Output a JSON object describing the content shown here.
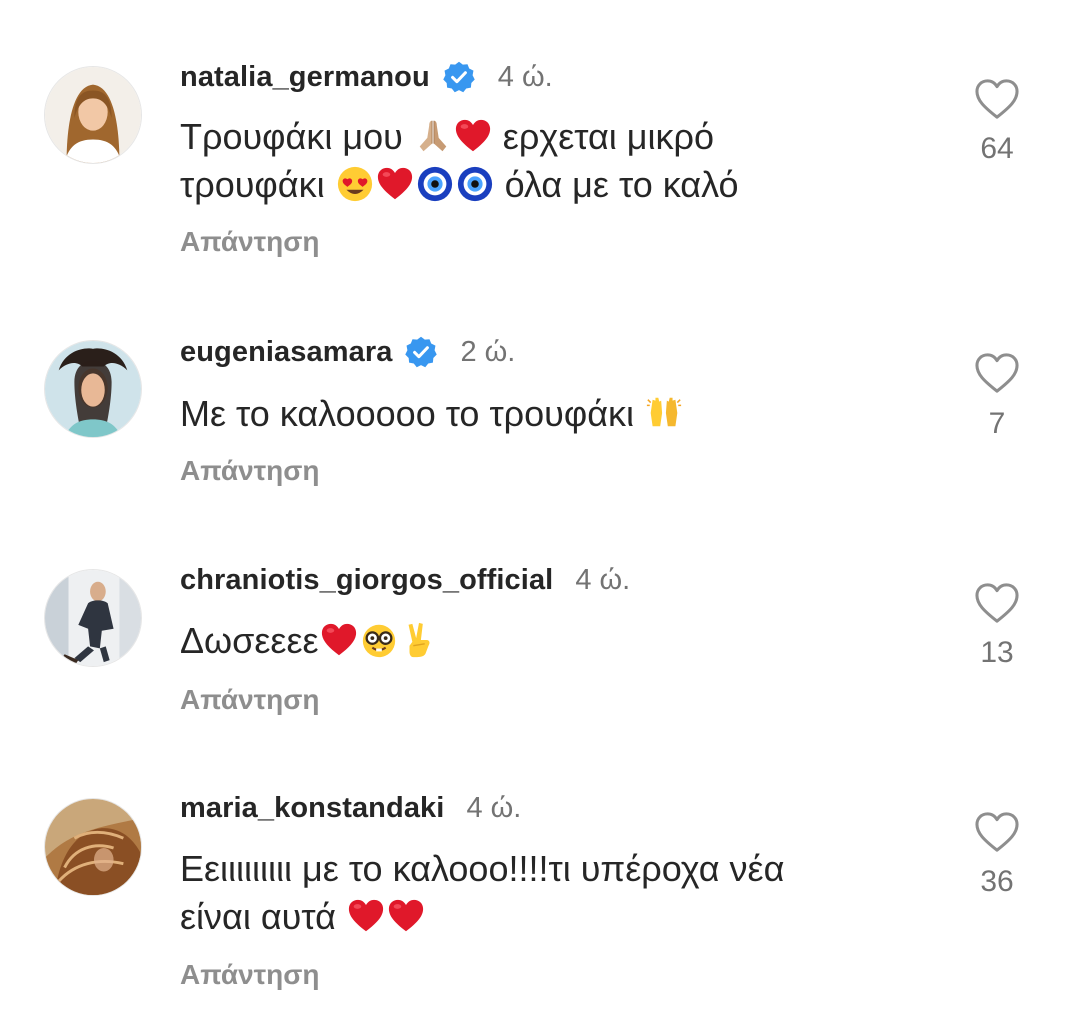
{
  "colors": {
    "primary_text": "#262626",
    "secondary_text": "#737373",
    "reply_text": "#8e8e8e",
    "verified_blue": "#3897f0"
  },
  "comments": [
    {
      "username": "natalia_germanou",
      "verified": true,
      "time": "4 ώ.",
      "text_part_1": "Τρουφάκι μου ",
      "text_part_2": " ερχεται μικρό",
      "text_part_3": "τρουφάκι ",
      "text_part_4": " όλα με το καλό",
      "reply_label": "Απάντηση",
      "likes": "64"
    },
    {
      "username": "eugeniasamara",
      "verified": true,
      "time": "2 ώ.",
      "text_part_1": "Με το καλοοοοο το τρουφάκι ",
      "reply_label": "Απάντηση",
      "likes": "7"
    },
    {
      "username": "chraniotis_giorgos_official",
      "verified": false,
      "time": "4 ώ.",
      "text_part_1": "Δωσεεεε",
      "reply_label": "Απάντηση",
      "likes": "13"
    },
    {
      "username": "maria_konstandaki",
      "verified": false,
      "time": "4 ώ.",
      "text_part_1": "Εειιιιιιιιι με το καλοοο!!!!τι υπέροχα νέα",
      "text_part_2": "είναι αυτά ",
      "reply_label": "Απάντηση",
      "likes": "36"
    }
  ],
  "icons": {
    "verified": "verified-badge-icon",
    "like": "heart-outline-icon",
    "emoji_pray": "folded-hands-emoji",
    "emoji_heart": "red-heart-emoji",
    "emoji_heart_eyes": "heart-eyes-emoji",
    "emoji_nazar": "nazar-amulet-emoji",
    "emoji_raised_hands": "raised-hands-emoji",
    "emoji_nerd": "nerd-face-emoji",
    "emoji_victory": "victory-hand-emoji"
  }
}
